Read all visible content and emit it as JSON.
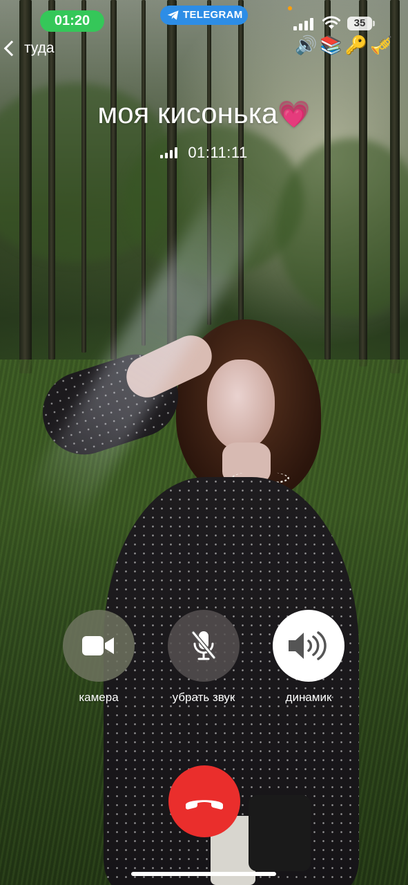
{
  "status_bar": {
    "time": "01:20",
    "telegram_label": "TELEGRAM",
    "battery": "35",
    "emojis": [
      "🔊",
      "📚",
      "🔑",
      "🎺"
    ]
  },
  "nav": {
    "back_label": "туда"
  },
  "call": {
    "contact_name": "моя кисонька",
    "contact_emoji": "💗",
    "duration": "01:11:11"
  },
  "controls": {
    "camera_label": "камера",
    "mute_label": "убрать звук",
    "speaker_label": "динамик"
  },
  "colors": {
    "time_pill": "#35c759",
    "telegram_pill": "#2d8de6",
    "end_call": "#ea2e2c"
  }
}
